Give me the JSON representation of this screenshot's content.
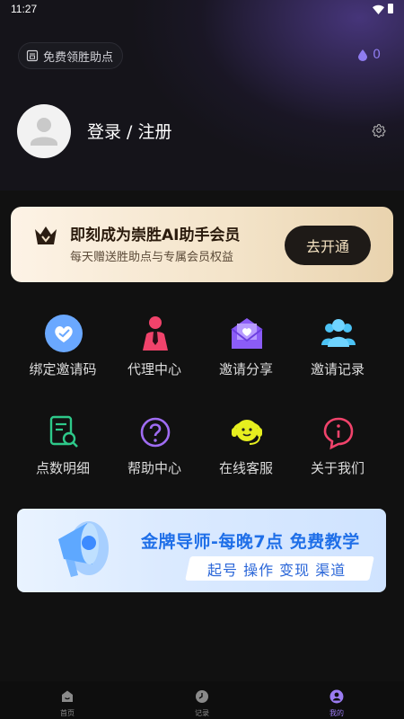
{
  "status_bar": {
    "time": "11:27"
  },
  "header": {
    "points_pill_label": "免费领胜助点",
    "balance": "0"
  },
  "profile": {
    "login_text": "登录 / 注册"
  },
  "vip_banner": {
    "title": "即刻成为崇胜AI助手会员",
    "subtitle": "每天赠送胜助点与专属会员权益",
    "button_label": "去开通"
  },
  "grid": {
    "items": [
      {
        "label": "绑定邀请码",
        "icon": "heart-badge-icon"
      },
      {
        "label": "代理中心",
        "icon": "agent-icon"
      },
      {
        "label": "邀请分享",
        "icon": "envelope-heart-icon"
      },
      {
        "label": "邀请记录",
        "icon": "users-icon"
      },
      {
        "label": "点数明细",
        "icon": "document-search-icon"
      },
      {
        "label": "帮助中心",
        "icon": "help-icon"
      },
      {
        "label": "在线客服",
        "icon": "headset-icon"
      },
      {
        "label": "关于我们",
        "icon": "info-icon"
      }
    ]
  },
  "promo": {
    "title": "金牌导师-每晚7点 免费教学",
    "tags": "起号 操作 变现 渠道"
  },
  "tabbar": {
    "tabs": [
      {
        "label": "首页",
        "icon": "home-icon"
      },
      {
        "label": "记录",
        "icon": "clock-icon"
      },
      {
        "label": "我的",
        "icon": "profile-icon"
      }
    ]
  },
  "colors": {
    "background": "#111111",
    "accent": "#9b7cf2",
    "vip_gold": "#f3e3c8",
    "promo_blue": "#1f6fe8"
  }
}
